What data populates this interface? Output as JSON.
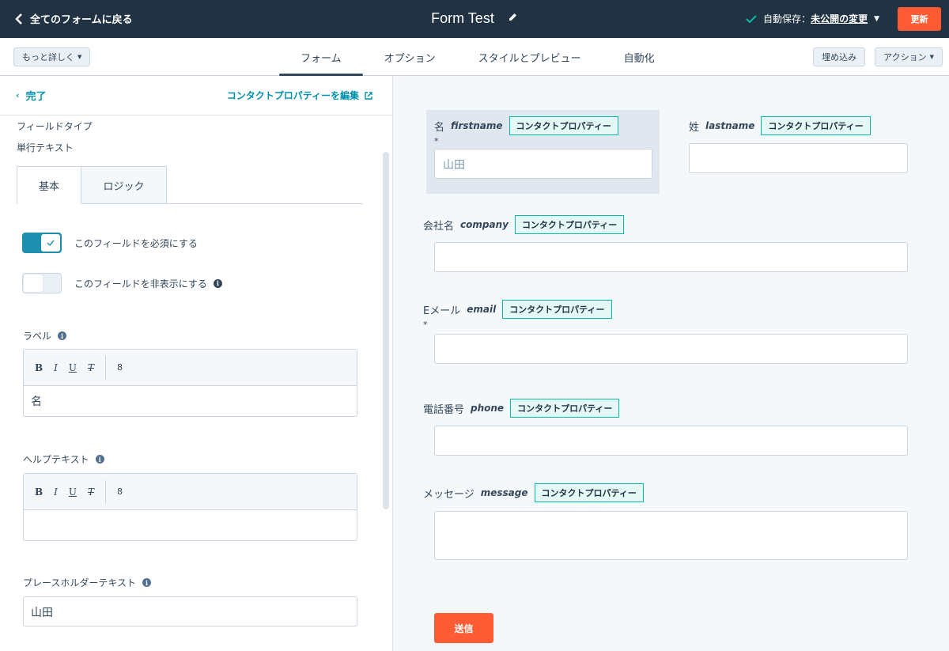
{
  "header": {
    "back_label": "全てのフォームに戻る",
    "form_title": "Form Test",
    "autosave_label": "自動保存：",
    "autosave_link": "未公開の変更",
    "update_label": "更新"
  },
  "subbar": {
    "more_label": "もっと詳しく",
    "tabs": [
      {
        "label": "フォーム",
        "active": true
      },
      {
        "label": "オプション",
        "active": false
      },
      {
        "label": "スタイルとプレビュー",
        "active": false
      },
      {
        "label": "自動化",
        "active": false
      }
    ],
    "embed_label": "埋め込み",
    "actions_label": "アクション"
  },
  "left_panel": {
    "done_label": "完了",
    "edit_property_label": "コンタクトプロパティーを編集",
    "field_type_heading": "フィールドタイプ",
    "field_type_value": "単行テキスト",
    "subtabs": [
      "基本",
      "ロジック"
    ],
    "required_toggle_label": "このフィールドを必須にする",
    "required_on": true,
    "hidden_toggle_label": "このフィールドを非表示にする",
    "hidden_on": false,
    "label_heading": "ラベル",
    "label_value": "名",
    "help_text_heading": "ヘルプテキスト",
    "help_text_value": "",
    "placeholder_heading": "プレースホルダーテキスト",
    "placeholder_value": "山田"
  },
  "preview": {
    "property_tag": "コンタクトプロパティー",
    "fields": [
      {
        "label": "名",
        "name": "firstname",
        "required": true,
        "placeholder": "山田"
      },
      {
        "label": "姓",
        "name": "lastname",
        "required": false,
        "placeholder": ""
      },
      {
        "label": "会社名",
        "name": "company",
        "required": false,
        "placeholder": ""
      },
      {
        "label": "Eメール",
        "name": "email",
        "required": true,
        "placeholder": ""
      },
      {
        "label": "電話番号",
        "name": "phone",
        "required": false,
        "placeholder": ""
      },
      {
        "label": "メッセージ",
        "name": "message",
        "required": false,
        "placeholder": ""
      }
    ],
    "required_mark": "*",
    "submit_label": "送信"
  }
}
